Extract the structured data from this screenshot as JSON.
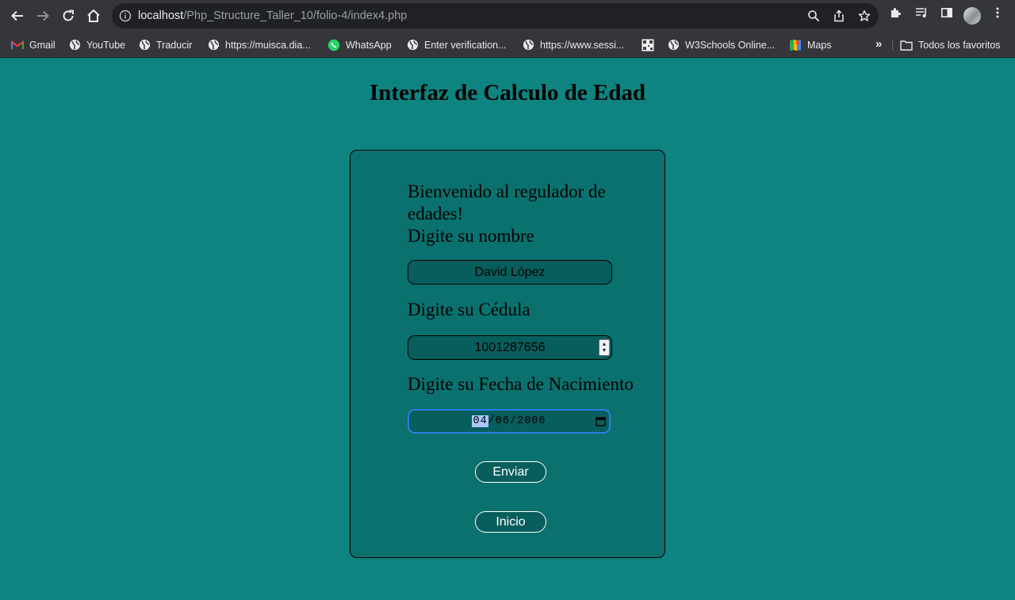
{
  "browser": {
    "url_host": "localhost",
    "url_path": "/Php_Structure_Taller_10/folio-4/index4.php",
    "bookmarks": [
      {
        "label": "Gmail",
        "icon": "gmail-icon"
      },
      {
        "label": "YouTube",
        "icon": "globe-icon"
      },
      {
        "label": "Traducir",
        "icon": "globe-icon"
      },
      {
        "label": "https://muisca.dia...",
        "icon": "globe-icon"
      },
      {
        "label": "WhatsApp",
        "icon": "whatsapp-icon"
      },
      {
        "label": "Enter verification...",
        "icon": "globe-icon"
      },
      {
        "label": "https://www.sessi...",
        "icon": "globe-icon"
      },
      {
        "label": "",
        "icon": "qr-icon"
      },
      {
        "label": "W3Schools Online...",
        "icon": "globe-icon"
      },
      {
        "label": "Maps",
        "icon": "maps-icon"
      }
    ],
    "more_label": "»",
    "all_bookmarks_label": "Todos los favoritos"
  },
  "page": {
    "title": "Interfaz de Calculo de Edad",
    "welcome": "Bienvenido al regulador de edades!",
    "name_label": "Digite su nombre",
    "name_value": "David López",
    "cedula_label": "Digite su Cédula",
    "cedula_value": "1001287656",
    "birth_label": "Digite su Fecha de Nacimiento",
    "birth_month": "04",
    "birth_rest": "/06/2006",
    "submit_label": "Enviar",
    "home_label": "Inicio"
  }
}
